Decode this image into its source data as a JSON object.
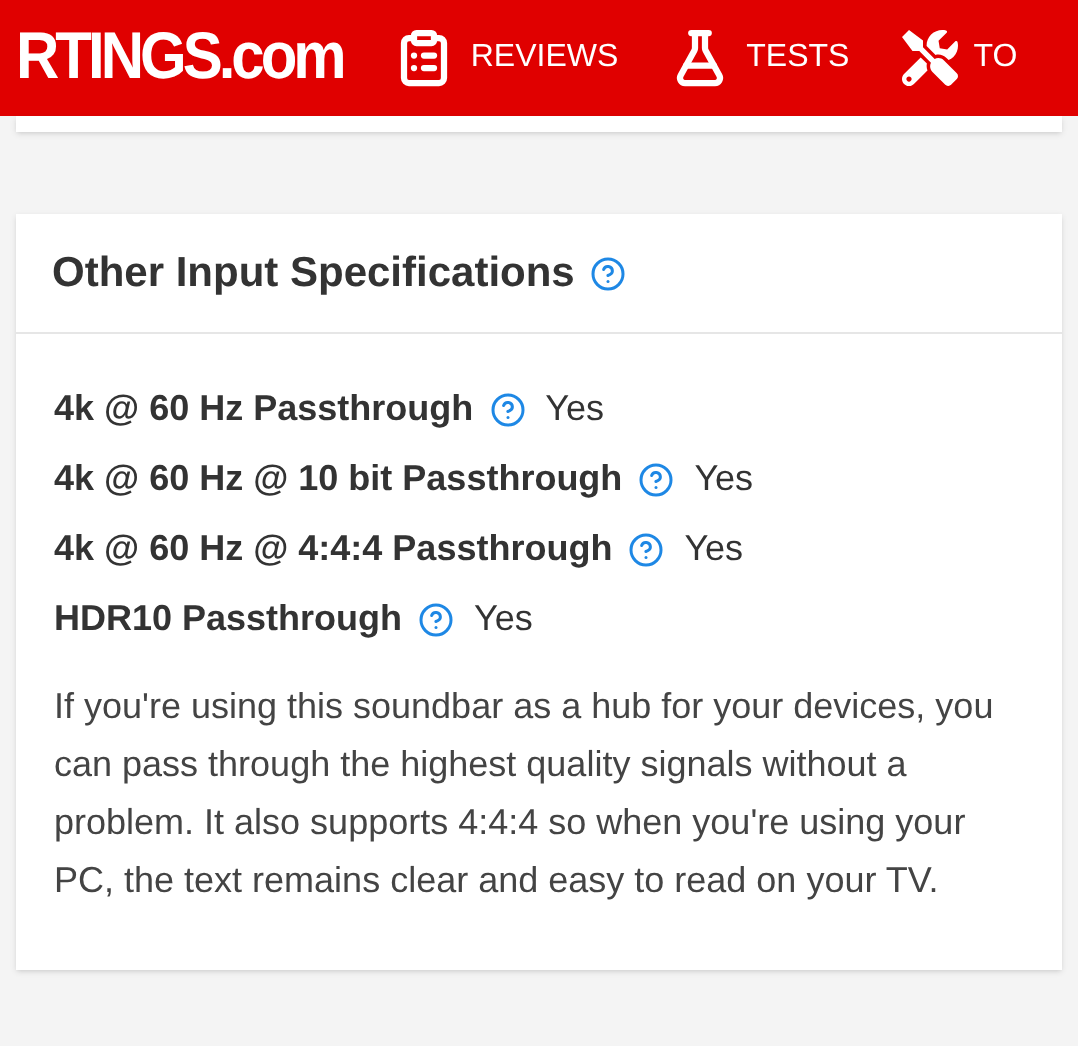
{
  "header": {
    "logo": "RTINGS.com",
    "nav": [
      {
        "label": "REVIEWS",
        "kind": "reviews"
      },
      {
        "label": "TESTS",
        "kind": "tests"
      },
      {
        "label": "TO",
        "kind": "tools"
      }
    ]
  },
  "card": {
    "title": "Other Input Specifications",
    "specs": [
      {
        "label": "4k @ 60 Hz Passthrough",
        "value": "Yes"
      },
      {
        "label": "4k @ 60 Hz @ 10 bit Passthrough",
        "value": "Yes"
      },
      {
        "label": "4k @ 60 Hz @ 4:4:4 Passthrough",
        "value": "Yes"
      },
      {
        "label": "HDR10 Passthrough",
        "value": "Yes"
      }
    ],
    "description": "If you're using this soundbar as a hub for your devices, you can pass through the highest quality signals without a problem. It also supports 4:4:4 so when you're using your PC, the text remains clear and easy to read on your TV."
  }
}
